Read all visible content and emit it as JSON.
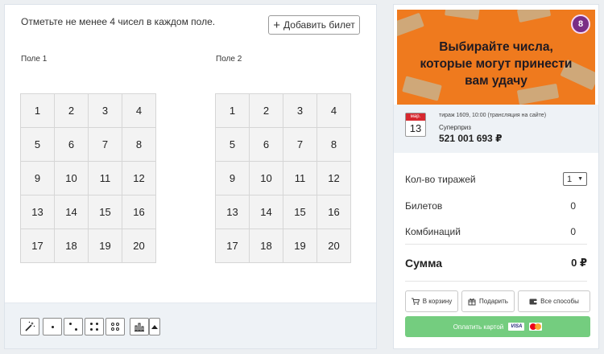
{
  "instruction": "Отметьте не менее 4 чисел в каждом поле.",
  "add_ticket": {
    "icon": "plus-icon",
    "label": "Добавить билет"
  },
  "fields": [
    {
      "label": "Поле 1",
      "numbers": [
        "1",
        "2",
        "3",
        "4",
        "5",
        "6",
        "7",
        "8",
        "9",
        "10",
        "11",
        "12",
        "13",
        "14",
        "15",
        "16",
        "17",
        "18",
        "19",
        "20"
      ]
    },
    {
      "label": "Поле 2",
      "numbers": [
        "1",
        "2",
        "3",
        "4",
        "5",
        "6",
        "7",
        "8",
        "9",
        "10",
        "11",
        "12",
        "13",
        "14",
        "15",
        "16",
        "17",
        "18",
        "19",
        "20"
      ]
    }
  ],
  "toolbar": {
    "icons": [
      "magic-wand-icon",
      "dice-one-icon",
      "dice-two-icon",
      "dice-four-icon",
      "dice-four-outline-icon",
      "bar-chart-icon",
      "caret-up-icon"
    ]
  },
  "banner": {
    "text_lines": [
      "Выбирайте числа,",
      "которые могут принести",
      "вам удачу"
    ],
    "ball_number": "8",
    "background": "#ef7a1e"
  },
  "draw": {
    "month": "мар.",
    "day": "13",
    "description": "тираж 1609, 10:00 (трансляция на сайте)",
    "game": "Суперприз",
    "prize": "521 001 693 ₽"
  },
  "summary": {
    "draws_label": "Кол-во тиражей",
    "draws_value": "1",
    "tickets_label": "Билетов",
    "tickets_value": "0",
    "combinations_label": "Комбинаций",
    "combinations_value": "0",
    "total_label": "Сумма",
    "total_value": "0 ₽"
  },
  "actions": {
    "cart": "В корзину",
    "gift": "Подарить",
    "all_methods": "Все способы",
    "pay_card": "Оплатить картой",
    "visa_label": "VISA"
  },
  "colors": {
    "pay_button": "#74cd7f",
    "calendar_red": "#d7282f",
    "ball_purple": "#7a2e86"
  }
}
